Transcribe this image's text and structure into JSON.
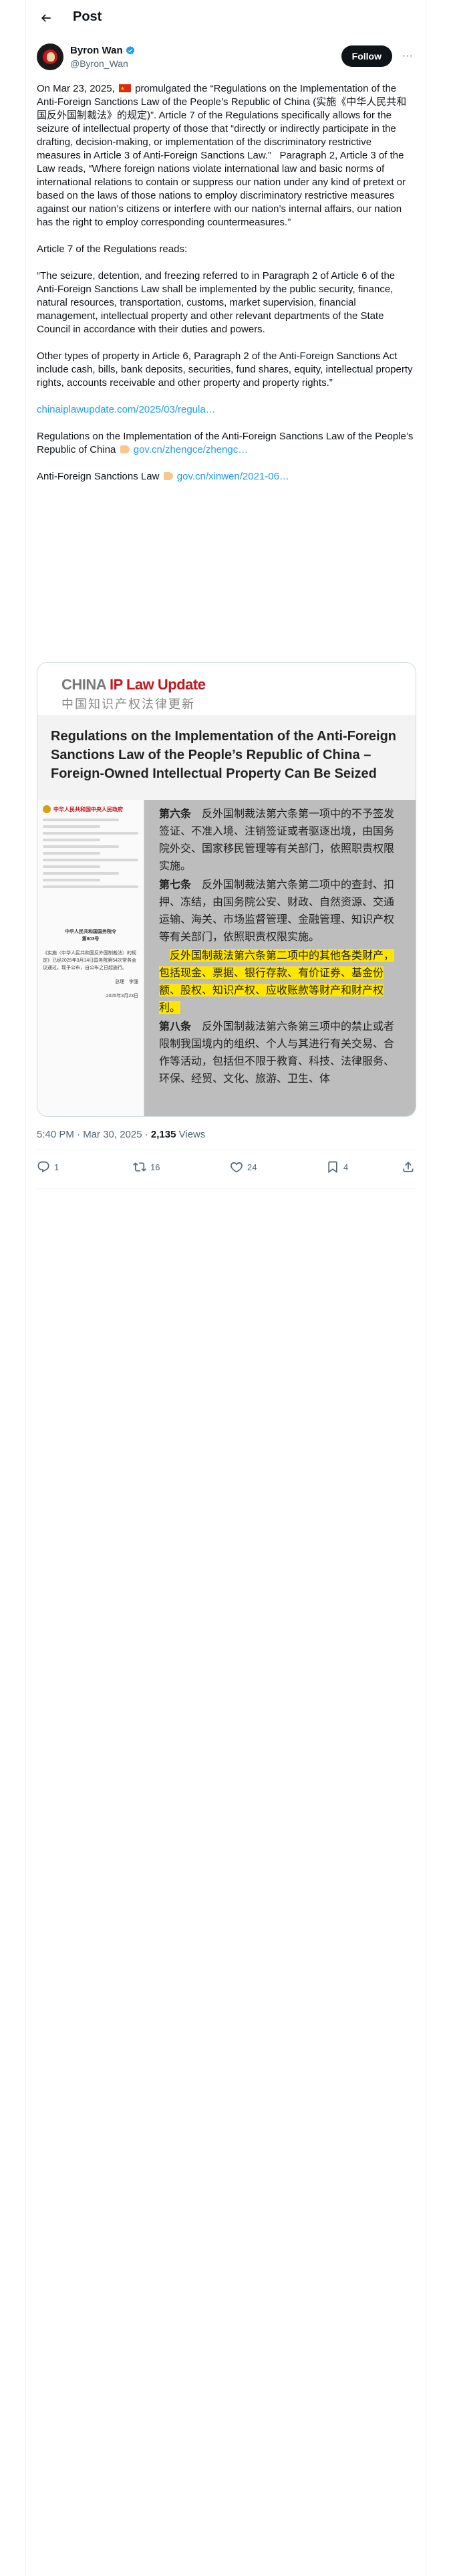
{
  "header": {
    "back_label": "Back",
    "title": "Post"
  },
  "author": {
    "name": "Byron Wan",
    "handle": "@Byron_Wan",
    "follow_label": "Follow",
    "more_label": "···"
  },
  "post": {
    "p1_before_flag": "On Mar 23, 2025, ",
    "p1_after_flag": " promulgated the “Regulations on the Implementation of the Anti-Foreign Sanctions Law of the People’s Republic of China (实施《中华人民共和国反外国制裁法》的规定)”. Article 7 of the Regulations specifically allows for the seizure of intellectual property of those that “directly or indirectly participate in the drafting, decision-making, or implementation of the discriminatory restrictive measures in Article 3 of Anti-Foreign Sanctions Law.”   Paragraph 2, Article 3 of the Law reads, “Where foreign nations violate international law and basic norms of international relations to contain or suppress our nation under any kind of pretext or based on the laws of those nations to employ discriminatory restrictive measures against our nation’s citizens or interfere with our nation’s internal affairs, our nation has the right to employ corresponding countermeasures.”",
    "p2": "Article 7 of the Regulations reads:",
    "p3": "“The seizure, detention, and freezing referred to in Paragraph 2 of Article 6 of the Anti-Foreign Sanctions Law shall be implemented by the public security, finance, natural resources, transportation, customs, market supervision, financial management, intellectual property and other relevant departments of the State Council in accordance with their duties and powers.",
    "p4": "Other types of property in Article 6, Paragraph 2 of the Anti-Foreign Sanctions Act include cash, bills, bank deposits, securities, fund shares, equity, intellectual property rights, accounts receivable and other property and property rights.”",
    "link1": "chinaiplawupdate.com/2025/03/regula…",
    "p5_text": "Regulations on the Implementation of the Anti-Foreign Sanctions Law of the People’s Republic of China ",
    "link2": "gov.cn/zhengce/zhengc…",
    "p6_text": "Anti-Foreign Sanctions Law ",
    "link3": "gov.cn/xinwen/2021-06…"
  },
  "media": {
    "logo_china": "CHINA",
    "logo_ip": "IP Law Update",
    "logo_cn": "中国知识产权法律更新",
    "headline": "Regulations on the Implementation of the Anti-Foreign Sanctions Law of the People’s Republic of China – Foreign-Owned Intellectual Property Can Be Seized",
    "gov_head": "中华人民共和国中央人民政府",
    "doc_title": "中华人民共和国国务院令",
    "doc_number": "第803号",
    "doc_bottom": "《实施〈中华人民共和国反外国制裁法〉的规定》已经2025年3月14日国务院第54次常务会议通过，现予公布，自公布之日起施行。",
    "doc_sign": "总理　李强",
    "doc_date": "2025年3月23日",
    "art6_lead": "第六条",
    "art6_text": "　反外国制裁法第六条第一项中的不予签发签证、不准入境、注销签证或者驱逐出境，由国务院外交、国家移民管理等有关部门，依照职责权限实施。",
    "art7_lead": "第七条",
    "art7_text": "　反外国制裁法第六条第二项中的查封、扣押、冻结，由国务院公安、财政、自然资源、交通运输、海关、市场监督管理、金融管理、知识产权等有关部门，依照职责权限实施。",
    "art7_hl": "反外国制裁法第六条第二项中的其他各类财产，包括现金、票据、银行存款、有价证券、基金份额、股权、知识产权、应收账款等财产和财产权利。",
    "art8_lead": "第八条",
    "art8_text": "　反外国制裁法第六条第三项中的禁止或者限制我国境内的组织、个人与其进行有关交易、合作等活动，包括但不限于教育、科技、法律服务、环保、经贸、文化、旅游、卫生、体"
  },
  "meta": {
    "time": "5:40 PM · Mar 30, 2025 · ",
    "views_count": "2,135",
    "views_label": " Views"
  },
  "actions": {
    "replies": "1",
    "reposts": "16",
    "likes": "24",
    "bookmarks": "4"
  },
  "colors": {
    "accent": "#1d9bf0",
    "text": "#0f1419",
    "muted": "#536471",
    "highlight": "#ffe600",
    "brand_red": "#c4161c"
  }
}
